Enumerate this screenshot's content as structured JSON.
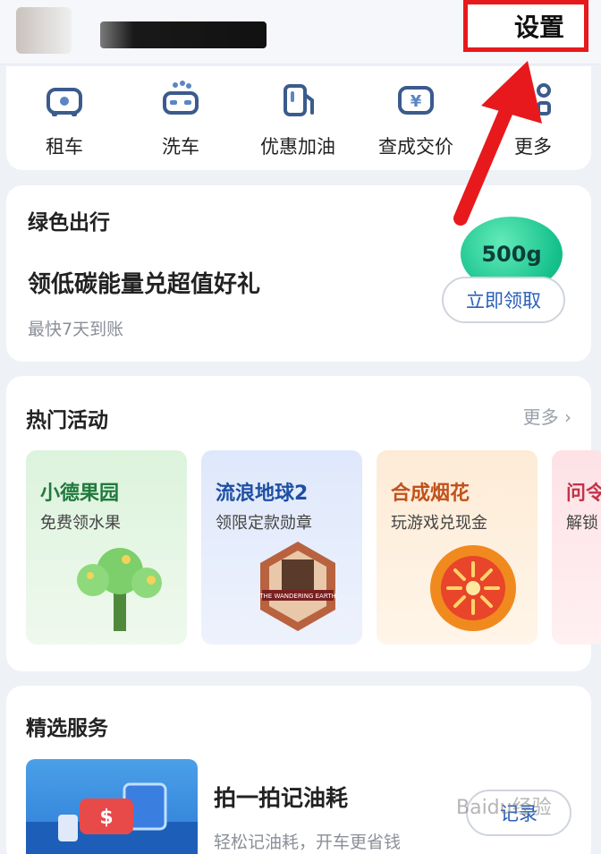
{
  "header": {
    "settings_label": "设置"
  },
  "quick_services": [
    {
      "label": "租车",
      "icon": "car-rental-icon"
    },
    {
      "label": "洗车",
      "icon": "car-wash-icon"
    },
    {
      "label": "优惠加油",
      "icon": "fuel-pump-icon"
    },
    {
      "label": "查成交价",
      "icon": "price-car-icon"
    },
    {
      "label": "更多",
      "icon": "more-grid-icon"
    }
  ],
  "green_travel": {
    "title": "绿色出行",
    "headline": "领低碳能量兑超值好礼",
    "subtitle": "最快7天到账",
    "energy_amount": "500g",
    "claim_label": "立即领取"
  },
  "hot_activities": {
    "title": "热门活动",
    "more_label": "更多",
    "items": [
      {
        "title": "小德果园",
        "subtitle": "免费领水果"
      },
      {
        "title": "流浪地球2",
        "subtitle": "领限定款勋章",
        "poster_text": "THE WANDERING EARTH"
      },
      {
        "title": "合成烟花",
        "subtitle": "玩游戏兑现金"
      },
      {
        "title": "问令",
        "subtitle": "解锁"
      }
    ]
  },
  "selected_services": {
    "title": "精选服务",
    "item": {
      "title": "拍一拍记油耗",
      "subtitle": "轻松记油耗，开车更省钱",
      "action_label": "记录"
    }
  },
  "watermark": "Baidu经验",
  "colors": {
    "accent_blue": "#2b5fb7",
    "highlight_red": "#e8191c",
    "energy_green": "#17c28c"
  }
}
